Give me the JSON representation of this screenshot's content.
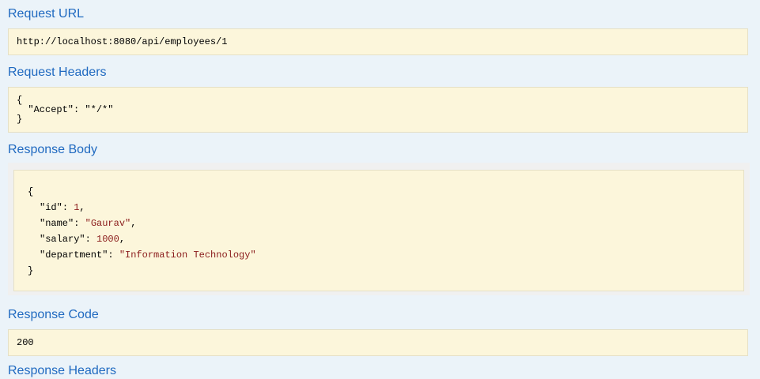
{
  "request_url": {
    "heading": "Request URL",
    "value": "http://localhost:8080/api/employees/1"
  },
  "request_headers": {
    "heading": "Request Headers",
    "line1": "{",
    "line2": "  \"Accept\": \"*/*\"",
    "line3": "}"
  },
  "response_body": {
    "heading": "Response Body",
    "open_brace": "{",
    "close_brace": "}",
    "fields": [
      {
        "key": "\"id\"",
        "value": "1",
        "suffix": ","
      },
      {
        "key": "\"name\"",
        "value": "\"Gaurav\"",
        "suffix": ","
      },
      {
        "key": "\"salary\"",
        "value": "1000",
        "suffix": ","
      },
      {
        "key": "\"department\"",
        "value": "\"Information Technology\"",
        "suffix": ""
      }
    ]
  },
  "response_code": {
    "heading": "Response Code",
    "value": "200"
  },
  "response_headers": {
    "heading": "Response Headers"
  },
  "colors": {
    "heading": "#1f69c0",
    "box_bg": "#fcf6db",
    "page_bg": "#ebf3f9",
    "string_value": "#8a1b1b"
  }
}
